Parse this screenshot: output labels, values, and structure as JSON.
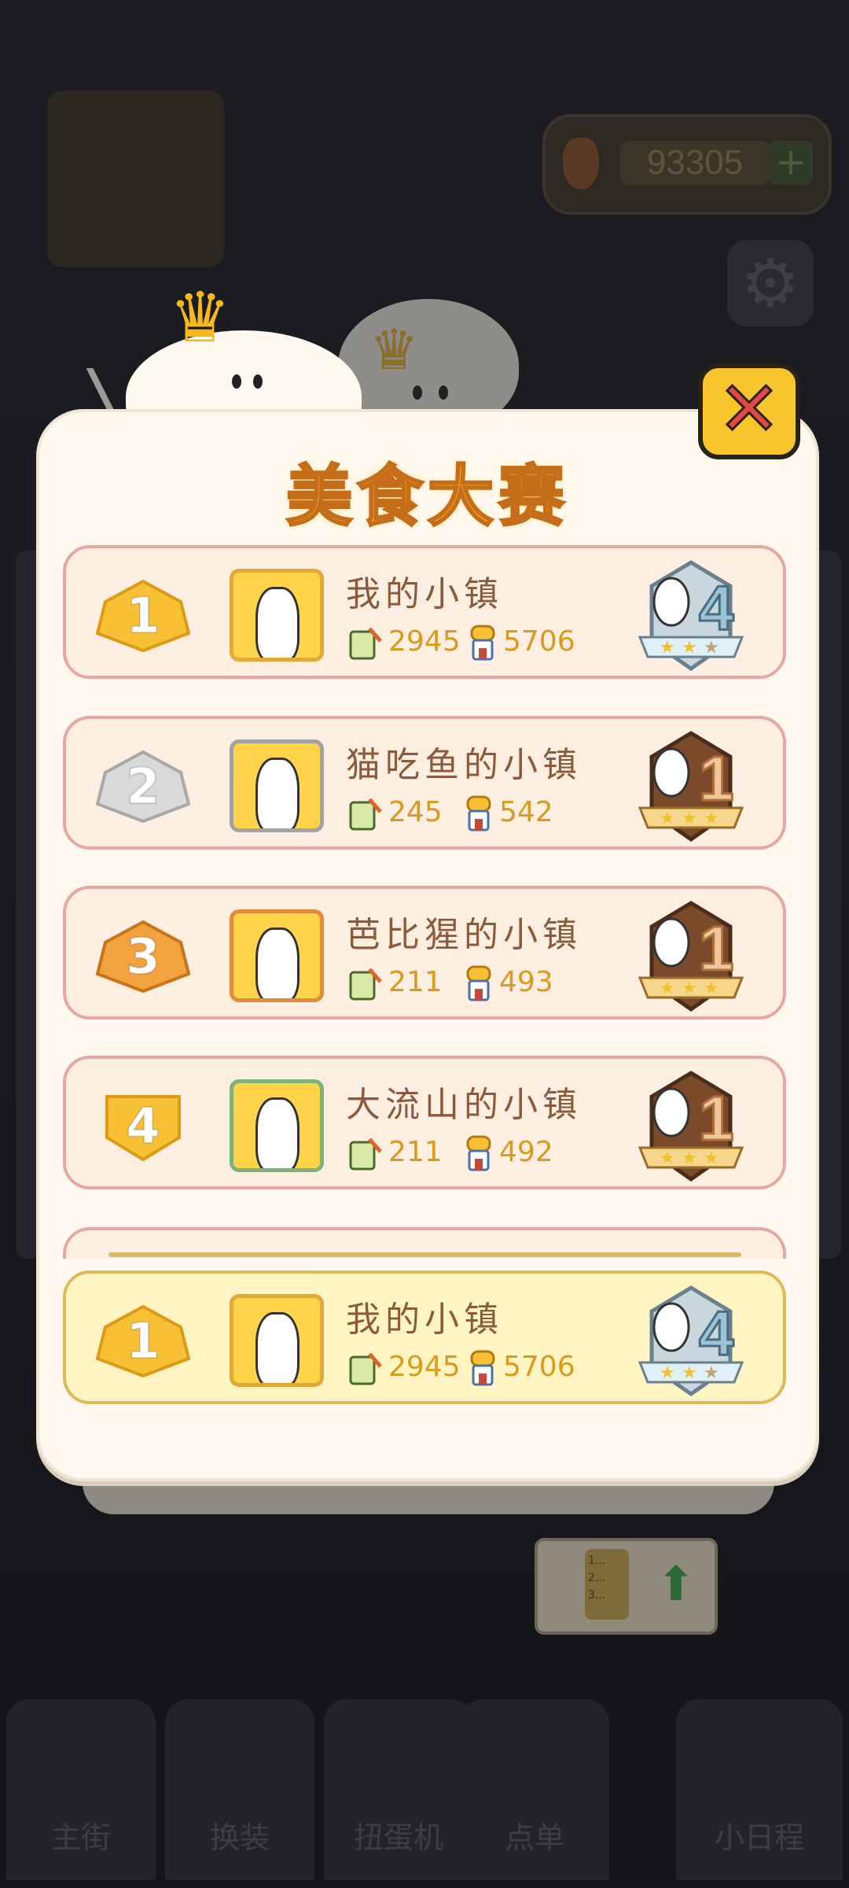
{
  "background": {
    "coins": "93305",
    "coin_plus": "+",
    "gear_glyph": "⚙",
    "nav": [
      "主街",
      "换装",
      "扭蛋机",
      "点单",
      "小日程"
    ],
    "order_board_lines": [
      "1...",
      "2...",
      "3..."
    ],
    "order_arrow": "⬆"
  },
  "panel": {
    "title": "美食大赛",
    "close_glyph": "✕"
  },
  "leaderboard": [
    {
      "rank": "1",
      "name": "我的小镇",
      "dishes": "2945",
      "score": "5706",
      "rank_color": "#f8c034",
      "avatar": "bunny"
    },
    {
      "rank": "2",
      "name": "猫吃鱼的小镇",
      "dishes": "245",
      "score": "542",
      "rank_color": "#d9d9d9",
      "avatar": "chef"
    },
    {
      "rank": "3",
      "name": "芭比猩的小镇",
      "dishes": "211",
      "score": "493",
      "rank_color": "#f3a33e",
      "avatar": "cap"
    },
    {
      "rank": "4",
      "name": "大流山的小镇",
      "dishes": "211",
      "score": "492",
      "rank_color": "#f8c034",
      "avatar": "bunny"
    }
  ],
  "my_entry": {
    "rank": "1",
    "name": "我的小镇",
    "dishes": "2945",
    "score": "5706"
  },
  "colors": {
    "title": "#f5a623",
    "stat_text": "#d99a1e",
    "name_text": "#8b5a3c",
    "row_bg": "#fdeee2",
    "my_row_bg": "#fff5c3"
  }
}
